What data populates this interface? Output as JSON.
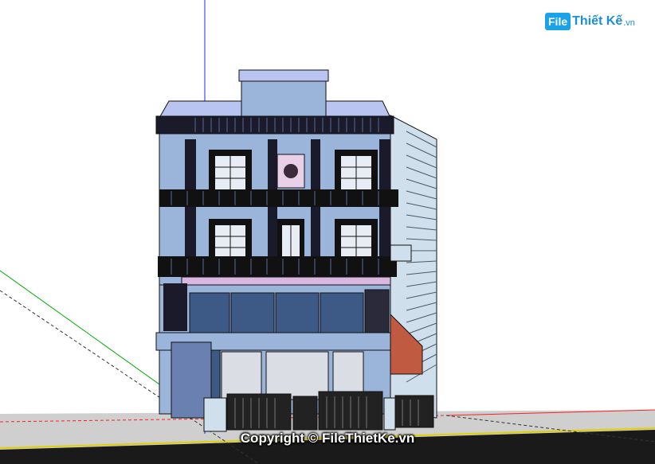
{
  "watermark": {
    "logo_badge": "File",
    "logo_name": "Thiết Kế",
    "logo_tld": ".vn",
    "copyright": "Copyright © FileThietKe.vn"
  },
  "colors": {
    "ground": "#c9c9c9",
    "road": "#1a1a1a",
    "curb_line": "#e0d000",
    "wall": "#9bb4d9",
    "glass": "#3d5a86",
    "frame": "#111111",
    "roof": "#b9c4f0",
    "pink_band": "#d8b8e0",
    "stair": "#c05a40",
    "side_wall": "#cfe0ec",
    "axis_blue": "#2020ff",
    "axis_green": "#00aa00",
    "axis_red": "#ff2020",
    "brand_blue": "#1aa3e8"
  },
  "scene": {
    "type": "3d-model-viewport",
    "subject": "four-storey townhouse facade"
  }
}
